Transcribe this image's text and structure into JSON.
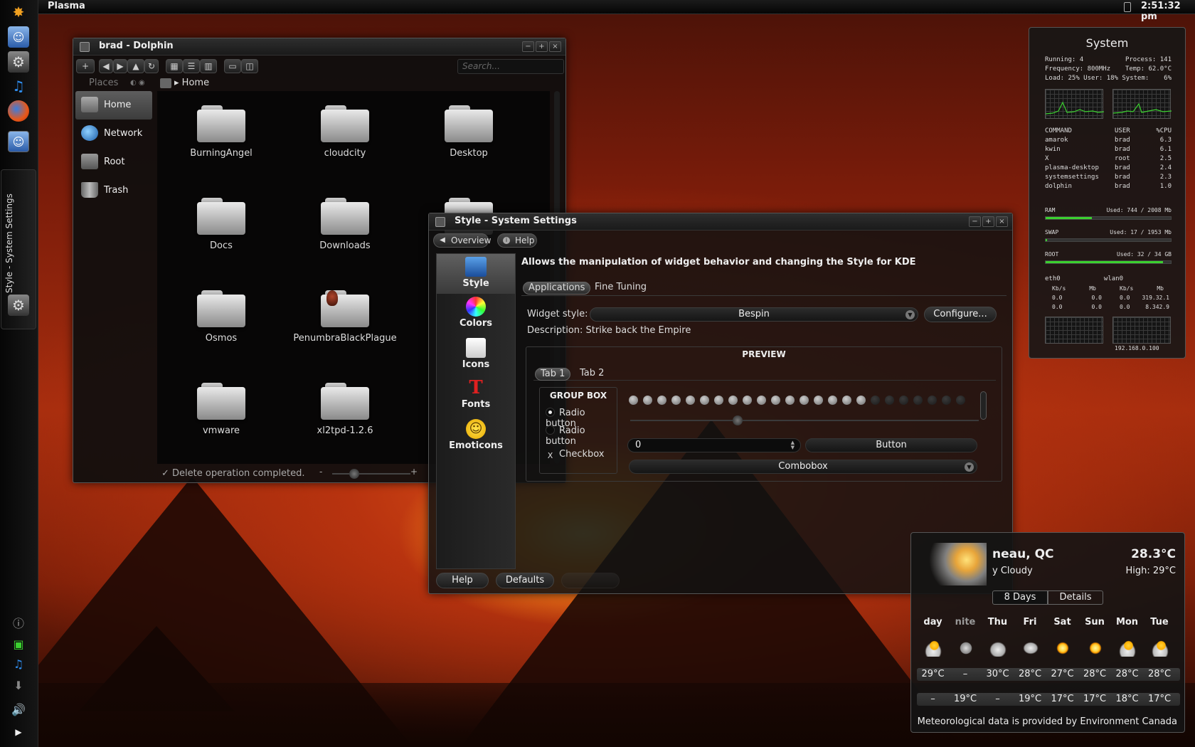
{
  "panel": {
    "activity_label": "Plasma",
    "clock": "2:51:32 pm"
  },
  "dock": {
    "task_label": "Style - System Settings",
    "icons": [
      "kde-menu-icon",
      "finder-icon",
      "settings-gear-icon",
      "music-note-icon",
      "firefox-icon",
      "finder-icon"
    ]
  },
  "dolphin": {
    "title": "brad - Dolphin",
    "search_placeholder": "Search...",
    "places_header": "Places",
    "places": [
      {
        "label": "Home"
      },
      {
        "label": "Network"
      },
      {
        "label": "Root"
      },
      {
        "label": "Trash"
      }
    ],
    "breadcrumb": "Home",
    "files": [
      {
        "name": "BurningAngel"
      },
      {
        "name": "cloudcity"
      },
      {
        "name": "Desktop"
      },
      {
        "name": "Docs"
      },
      {
        "name": "Downloads"
      },
      {
        "name": "Osmos"
      },
      {
        "name": "PenumbraBlackPlague"
      },
      {
        "name": "vmware"
      },
      {
        "name": "xl2tpd-1.2.6"
      }
    ],
    "status": "Delete operation completed.",
    "zoom_minus": "-",
    "zoom_plus": "+"
  },
  "settings": {
    "title": "Style - System Settings",
    "nav": {
      "overview": "Overview",
      "help": "Help"
    },
    "categories": [
      {
        "label": "Style"
      },
      {
        "label": "Colors"
      },
      {
        "label": "Icons"
      },
      {
        "label": "Fonts"
      },
      {
        "label": "Emoticons"
      }
    ],
    "description": "Allows the manipulation of widget behavior and changing the Style for KDE",
    "tabs": [
      "Applications",
      "Fine Tuning"
    ],
    "widget_style_label": "Widget style:",
    "widget_style_value": "Bespin",
    "configure_label": "Configure...",
    "style_description": "Description: Strike back the Empire",
    "preview": {
      "title": "PREVIEW",
      "tabs": [
        "Tab 1",
        "Tab 2"
      ],
      "group_title": "GROUP BOX",
      "radio1": "Radio button",
      "radio2": "Radio button",
      "checkbox": "Checkbox",
      "checkbox_mark": "X",
      "spin_value": "0",
      "button": "Button",
      "combobox": "Combobox",
      "progress_filled": 17,
      "progress_total": 24
    },
    "footer": {
      "help": "Help",
      "defaults": "Defaults"
    }
  },
  "sysmon": {
    "title": "System",
    "stats": [
      [
        "Running: 4",
        "Process: 141"
      ],
      [
        "Frequency: 800MHz",
        "Temp: 62.0°C"
      ],
      [
        "Load:  25% User: 18% System:",
        "6%"
      ]
    ],
    "proc_headers": [
      "COMMAND",
      "USER",
      "%CPU"
    ],
    "processes": [
      [
        "amarok",
        "brad",
        "6.3"
      ],
      [
        "kwin",
        "brad",
        "6.1"
      ],
      [
        "X",
        "root",
        "2.5"
      ],
      [
        "plasma-desktop",
        "brad",
        "2.4"
      ],
      [
        "systemsettings",
        "brad",
        "2.3"
      ],
      [
        "dolphin",
        "brad",
        "1.0"
      ]
    ],
    "bars": [
      {
        "label": "RAM",
        "value": "Used: 744 / 2008 Mb",
        "fraction": 0.37
      },
      {
        "label": "SWAP",
        "value": "Used: 17 / 1953 Mb",
        "fraction": 0.01
      },
      {
        "label": "ROOT",
        "value": "Used: 32 / 34 GB",
        "fraction": 0.94
      }
    ],
    "eth": {
      "name": "eth0",
      "cols": [
        "Kb/s",
        "Mb"
      ],
      "rows": [
        [
          "0.0",
          "0.0"
        ],
        [
          "0.0",
          "0.0"
        ]
      ]
    },
    "wlan": {
      "name": "wlan0",
      "cols": [
        "Kb/s",
        "Mb"
      ],
      "rows": [
        [
          "0.0",
          "319.32.1"
        ],
        [
          "0.0",
          "8.342.9"
        ]
      ]
    },
    "ip": "192.168.0.100"
  },
  "weather": {
    "city": "neau, QC",
    "temp": "28.3°C",
    "condition": "y Cloudy",
    "high": "High: 29°C",
    "tabs": [
      "8 Days",
      "Details"
    ],
    "days": [
      "day",
      "nite",
      "Thu",
      "Fri",
      "Sat",
      "Sun",
      "Mon",
      "Tue"
    ],
    "icons": [
      "partly-cloudy-icon",
      "moon-icon",
      "cloudy-icon",
      "rain-cloud-icon",
      "sun-icon",
      "sun-icon",
      "partly-cloudy-icon",
      "partly-cloudy-icon"
    ],
    "highs": [
      "29°C",
      "–",
      "30°C",
      "28°C",
      "27°C",
      "28°C",
      "28°C",
      "28°C"
    ],
    "lows": [
      "–",
      "19°C",
      "–",
      "19°C",
      "17°C",
      "17°C",
      "18°C",
      "17°C"
    ],
    "credit": "Meteorological data is provided by Environment Canada"
  },
  "colors": {
    "accent_green": "#3bd12f",
    "sun_yellow": "#ffd23a"
  }
}
